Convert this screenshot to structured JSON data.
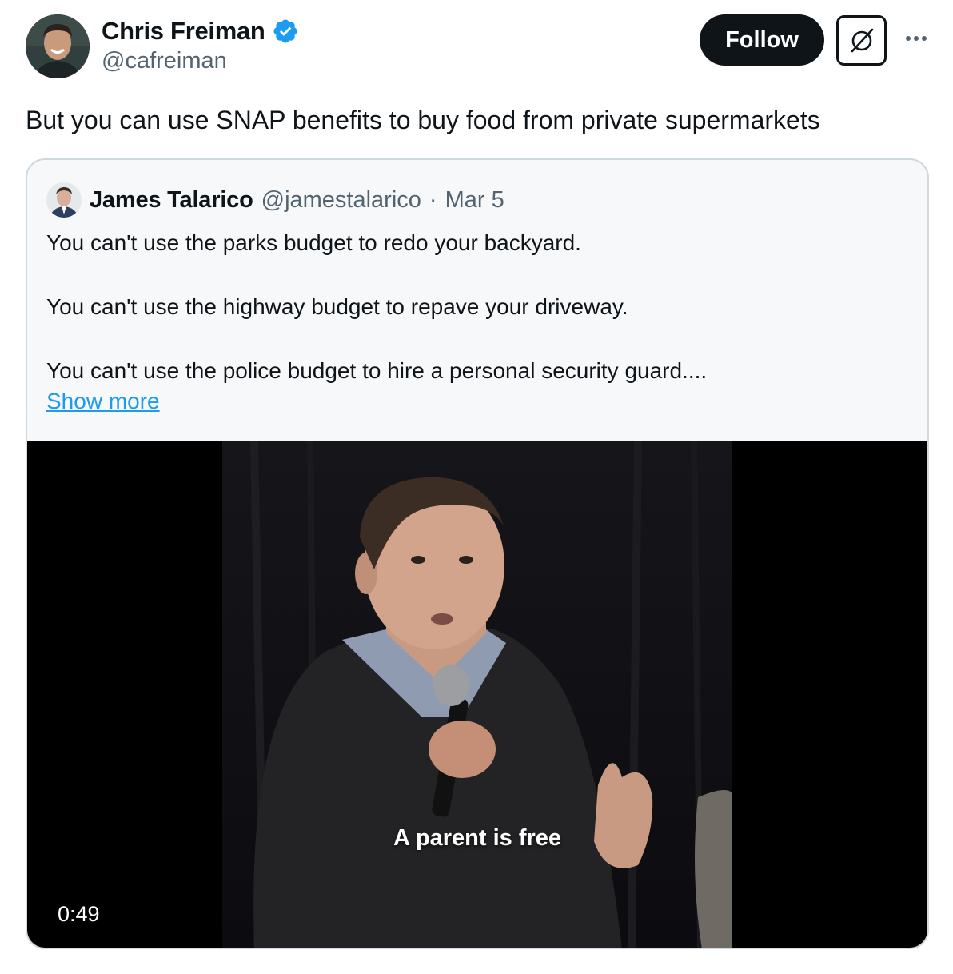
{
  "author": {
    "name": "Chris Freiman",
    "handle": "@cafreiman",
    "verified": true
  },
  "actions": {
    "follow_label": "Follow"
  },
  "tweet": {
    "text": "But you can use SNAP benefits to buy food from private supermarkets"
  },
  "quoted_tweet": {
    "author_name": "James Talarico",
    "author_handle": "@jamestalarico",
    "separator": "·",
    "date": "Mar 5",
    "paragraphs": [
      "You can't use the parks budget to redo your backyard.",
      "You can't use the highway budget to repave your driveway.",
      "You can't use the police budget to hire a personal security guard...."
    ],
    "show_more_label": "Show more",
    "video": {
      "caption": "A parent is free",
      "duration": "0:49"
    }
  },
  "colors": {
    "text_primary": "#0f1419",
    "text_secondary": "#536471",
    "link": "#1d9bf0",
    "verified_badge": "#1d9bf0",
    "border": "#cfd9de",
    "quote_background": "#f7f8f9"
  },
  "icons": {
    "verified": "verified-badge-icon",
    "grok": "grok-icon",
    "more": "more-icon"
  }
}
